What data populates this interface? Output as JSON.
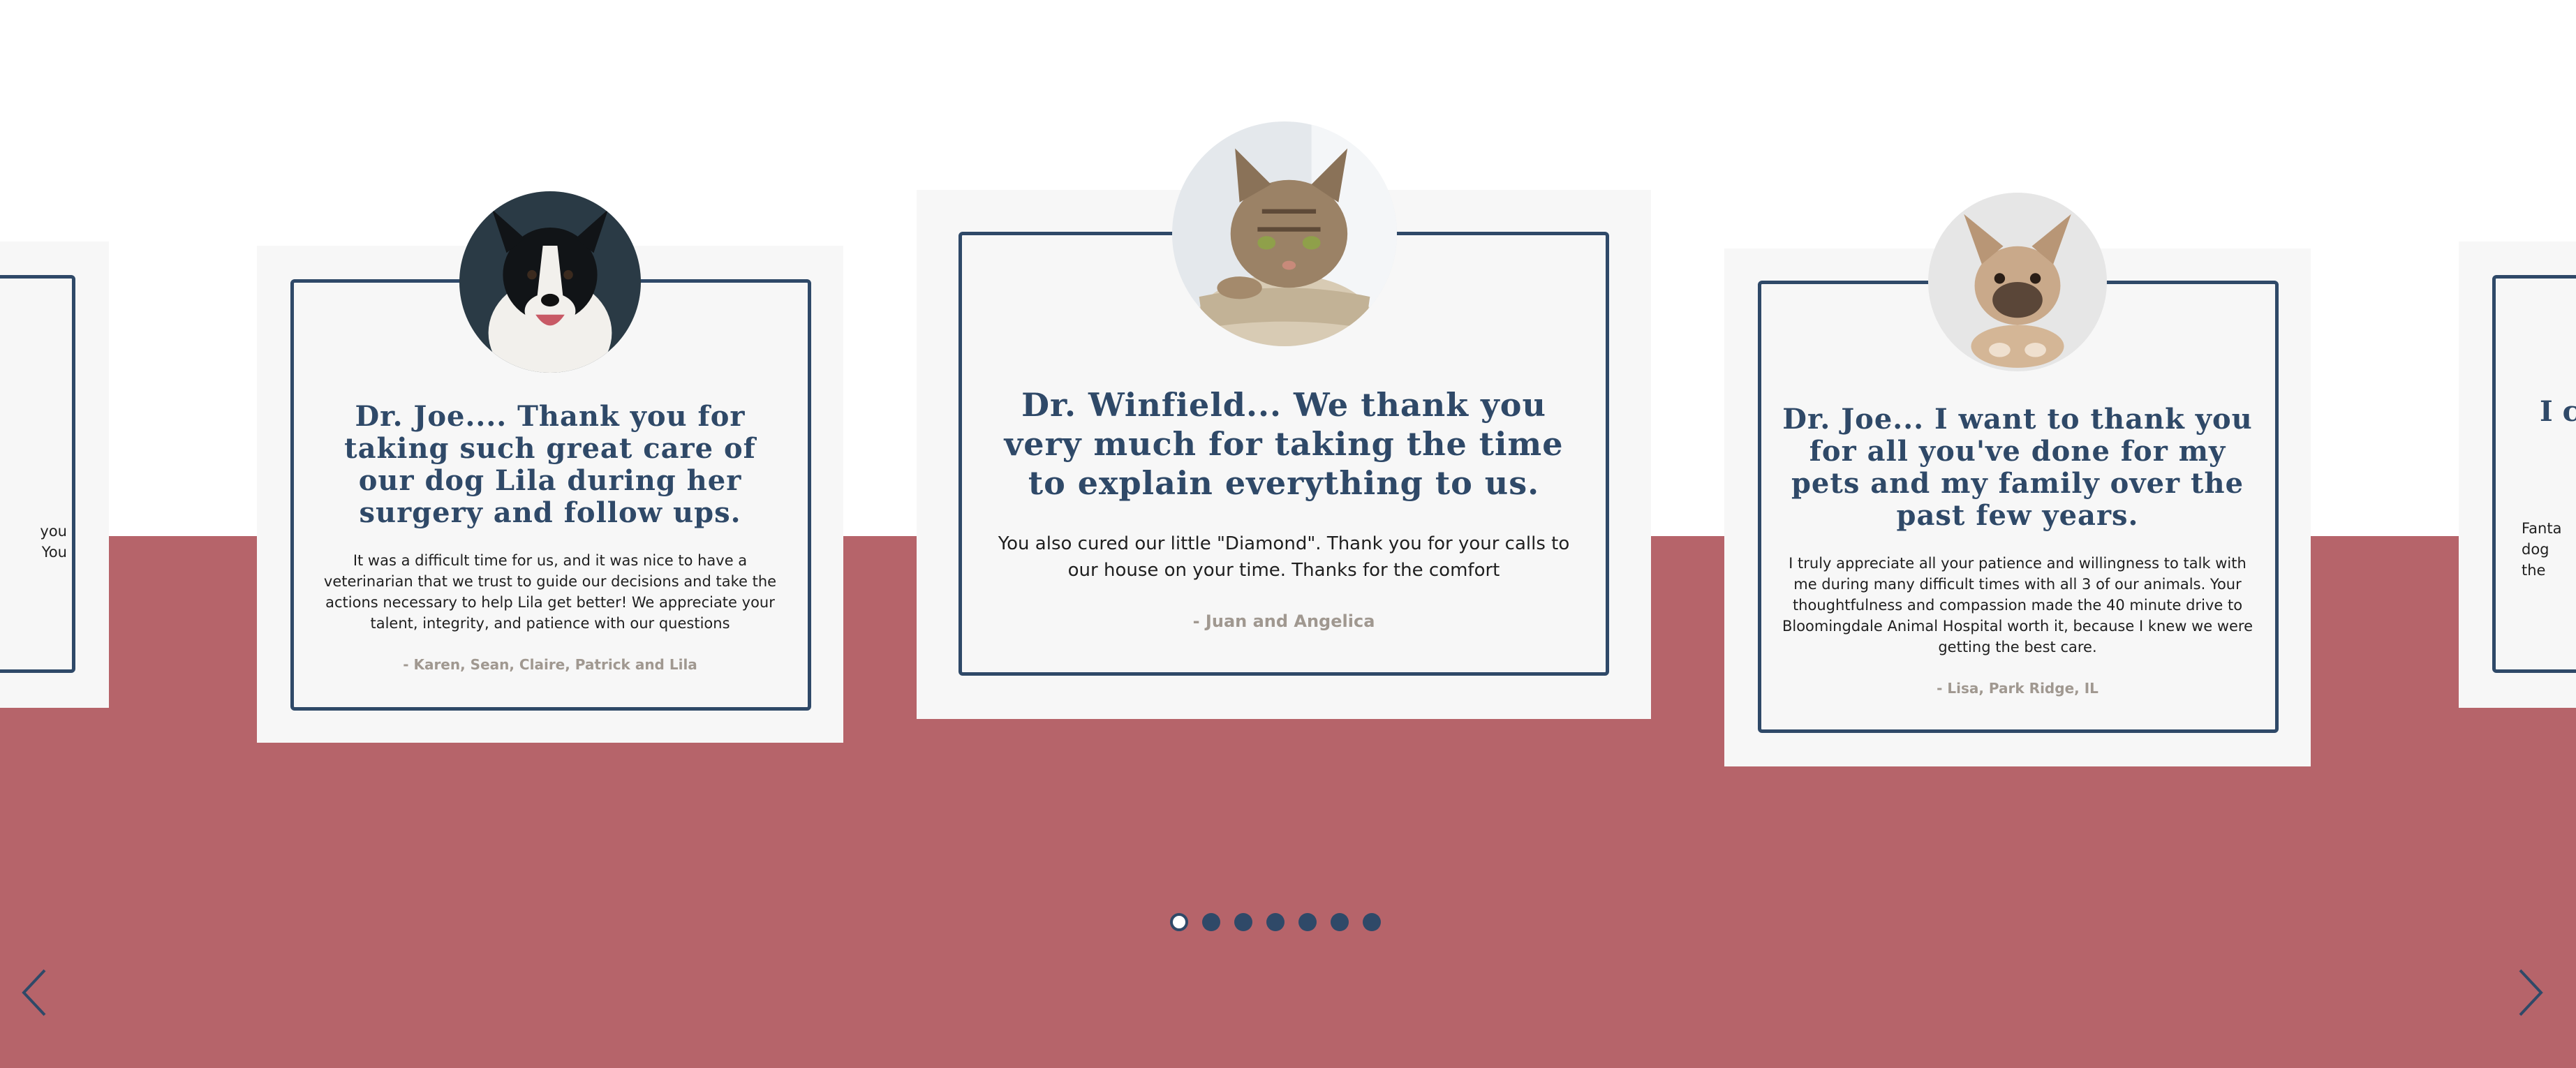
{
  "colors": {
    "band": "#b6646a",
    "navy": "#2f4968",
    "card_bg": "#f7f7f7",
    "author": "#a09890"
  },
  "testimonials": [
    {
      "quote": "Dr. Joe.... Thank you for taking such great care of our dog Lila during her surgery and follow ups.",
      "body": "It was a difficult time for us, and it was nice to have a veterinarian that we trust to guide our decisions and take the actions necessary to help Lila get better! We appreciate your talent, integrity, and patience with our questions",
      "author": "- Karen, Sean, Claire, Patrick and Lila",
      "avatar": "border-collie-dog"
    },
    {
      "quote": "Dr. Winfield... We thank you very much for taking the time to explain everything to us.",
      "body": "You also cured our little \"Diamond\". Thank you for your calls to our house on your time. Thanks for the comfort",
      "author": "- Juan and Angelica",
      "avatar": "tabby-cat-in-basket"
    },
    {
      "quote": "Dr. Joe... I want to thank you for all you've done for my pets and my family over the past few years.",
      "body": "I truly appreciate all your patience and willingness to talk with me during many difficult times with all 3 of our animals. Your thoughtfulness and compassion made the 40 minute drive to Bloomingdale Animal Hospital worth it, because I knew we were getting the best care.",
      "author": "- Lisa, Park Ridge, IL",
      "avatar": "french-bulldog"
    }
  ],
  "partial_left": {
    "text_line1": "you",
    "text_line2": "You"
  },
  "partial_right": {
    "title": "I c",
    "text_line1": "Fanta",
    "text_line2": "dog",
    "text_line3": "the"
  },
  "pagination": {
    "total": 7,
    "active": 1
  },
  "icons": {
    "prev": "chevron-left-icon",
    "next": "chevron-right-icon"
  }
}
